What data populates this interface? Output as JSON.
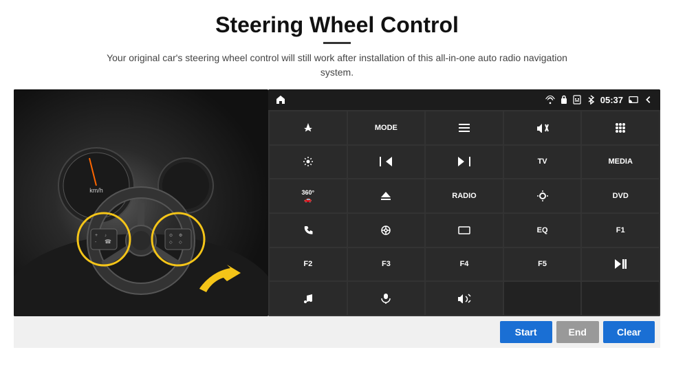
{
  "header": {
    "title": "Steering Wheel Control",
    "subtitle": "Your original car's steering wheel control will still work after installation of this all-in-one auto radio navigation system."
  },
  "status_bar": {
    "time": "05:37",
    "icons": [
      "wifi",
      "lock",
      "sim",
      "bluetooth",
      "cast",
      "back"
    ]
  },
  "button_grid": [
    {
      "label": "▲",
      "type": "icon",
      "row": 1,
      "col": 1
    },
    {
      "label": "MODE",
      "type": "text",
      "row": 1,
      "col": 2
    },
    {
      "label": "≡",
      "type": "icon",
      "row": 1,
      "col": 3
    },
    {
      "label": "🔇",
      "type": "icon",
      "row": 1,
      "col": 4
    },
    {
      "label": "⋯",
      "type": "icon",
      "row": 1,
      "col": 5
    },
    {
      "label": "⚙",
      "type": "icon",
      "row": 2,
      "col": 1
    },
    {
      "label": "⏮",
      "type": "icon",
      "row": 2,
      "col": 2
    },
    {
      "label": "⏭",
      "type": "icon",
      "row": 2,
      "col": 3
    },
    {
      "label": "TV",
      "type": "text",
      "row": 2,
      "col": 4
    },
    {
      "label": "MEDIA",
      "type": "text",
      "row": 2,
      "col": 5
    },
    {
      "label": "360°",
      "type": "text",
      "row": 3,
      "col": 1
    },
    {
      "label": "▲",
      "type": "icon",
      "row": 3,
      "col": 2
    },
    {
      "label": "RADIO",
      "type": "text",
      "row": 3,
      "col": 3
    },
    {
      "label": "☀",
      "type": "icon",
      "row": 3,
      "col": 4
    },
    {
      "label": "DVD",
      "type": "text",
      "row": 3,
      "col": 5
    },
    {
      "label": "📞",
      "type": "icon",
      "row": 4,
      "col": 1
    },
    {
      "label": "◎",
      "type": "icon",
      "row": 4,
      "col": 2
    },
    {
      "label": "▭",
      "type": "icon",
      "row": 4,
      "col": 3
    },
    {
      "label": "EQ",
      "type": "text",
      "row": 4,
      "col": 4
    },
    {
      "label": "F1",
      "type": "text",
      "row": 4,
      "col": 5
    },
    {
      "label": "F2",
      "type": "text",
      "row": 5,
      "col": 1
    },
    {
      "label": "F3",
      "type": "text",
      "row": 5,
      "col": 2
    },
    {
      "label": "F4",
      "type": "text",
      "row": 5,
      "col": 3
    },
    {
      "label": "F5",
      "type": "text",
      "row": 5,
      "col": 4
    },
    {
      "label": "▶⏸",
      "type": "icon",
      "row": 5,
      "col": 5
    },
    {
      "label": "♫",
      "type": "icon",
      "row": 6,
      "col": 1
    },
    {
      "label": "🎤",
      "type": "icon",
      "row": 6,
      "col": 2
    },
    {
      "label": "🔊",
      "type": "icon",
      "row": 6,
      "col": 3
    },
    {
      "label": "",
      "type": "empty",
      "row": 6,
      "col": 4
    },
    {
      "label": "",
      "type": "empty",
      "row": 6,
      "col": 5
    }
  ],
  "bottom_buttons": {
    "start": "Start",
    "end": "End",
    "clear": "Clear"
  }
}
